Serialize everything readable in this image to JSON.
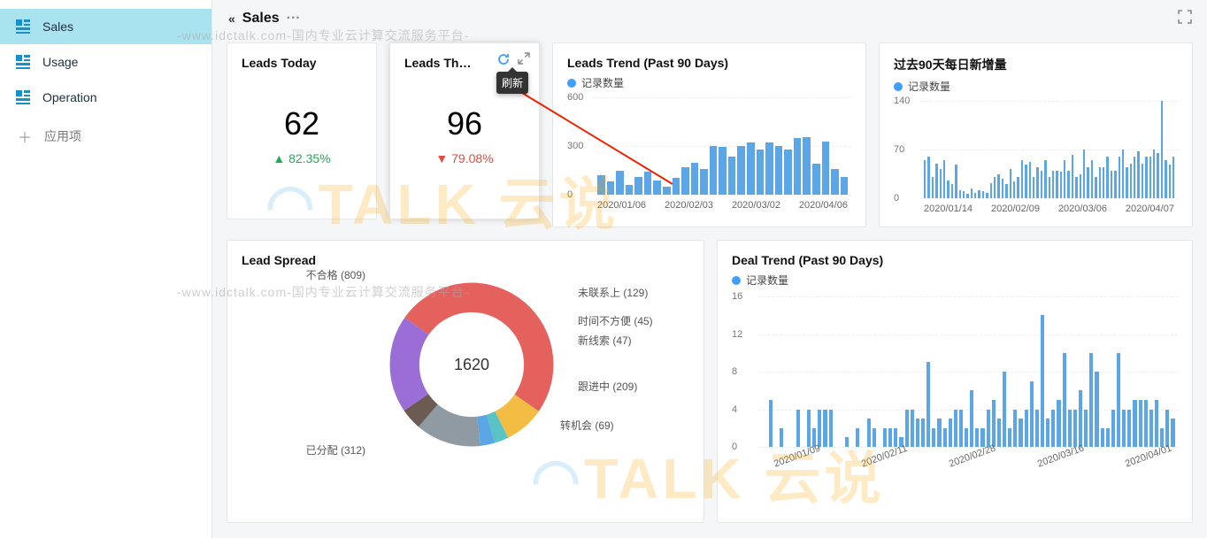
{
  "sidebar": {
    "items": [
      {
        "label": "Sales"
      },
      {
        "label": "Usage"
      },
      {
        "label": "Operation"
      }
    ],
    "add_label": "应用项"
  },
  "header": {
    "collapse_glyph": "«",
    "title": "Sales",
    "more_glyph": "···"
  },
  "tooltip_refresh": "刷新",
  "kpi_today": {
    "title": "Leads Today",
    "value": "62",
    "delta": "82.35%",
    "direction": "up"
  },
  "kpi_week": {
    "title": "Leads Th…",
    "value": "96",
    "delta": "79.08%",
    "direction": "down"
  },
  "leads_trend": {
    "title": "Leads Trend (Past 90 Days)",
    "legend": "记录数量",
    "ylim": [
      0,
      600
    ],
    "yticks": [
      "600",
      "300",
      "0"
    ],
    "xlabels": [
      "2020/01/06",
      "2020/02/03",
      "2020/03/02",
      "2020/04/06"
    ],
    "values": [
      120,
      80,
      145,
      60,
      110,
      140,
      90,
      50,
      105,
      170,
      195,
      160,
      300,
      295,
      235,
      300,
      320,
      280,
      320,
      300,
      280,
      350,
      355,
      190,
      325,
      160,
      110
    ]
  },
  "daily_new": {
    "title": "过去90天每日新增量",
    "legend": "记录数量",
    "ylim": [
      0,
      140
    ],
    "yticks": [
      "140",
      "70",
      "0"
    ],
    "xlabels": [
      "2020/01/14",
      "2020/02/09",
      "2020/03/06",
      "2020/04/07"
    ],
    "values": [
      55,
      60,
      30,
      50,
      42,
      55,
      26,
      20,
      48,
      12,
      10,
      6,
      14,
      8,
      12,
      10,
      8,
      22,
      30,
      35,
      28,
      20,
      42,
      24,
      30,
      55,
      48,
      52,
      30,
      44,
      40,
      55,
      30,
      40,
      40,
      38,
      55,
      40,
      62,
      30,
      35,
      70,
      45,
      55,
      30,
      44,
      45,
      60,
      40,
      40,
      60,
      70,
      45,
      50,
      60,
      68,
      50,
      60,
      60,
      70,
      65,
      140,
      55,
      48,
      60
    ]
  },
  "lead_spread": {
    "title": "Lead Spread",
    "total": "1620",
    "slices": [
      {
        "label": "不合格 (809)",
        "value": 809,
        "color": "#e5615e"
      },
      {
        "label": "未联系上 (129)",
        "value": 129,
        "color": "#f2bd42"
      },
      {
        "label": "时间不方便 (45)",
        "value": 45,
        "color": "#58c4c8"
      },
      {
        "label": "新线索 (47)",
        "value": 47,
        "color": "#5aa6e6"
      },
      {
        "label": "跟进中 (209)",
        "value": 209,
        "color": "#8f9aa3"
      },
      {
        "label": "转机会 (69)",
        "value": 69,
        "color": "#6b5b52"
      },
      {
        "label": "已分配 (312)",
        "value": 312,
        "color": "#9a6dd7"
      }
    ]
  },
  "deal_trend": {
    "title": "Deal Trend (Past 90 Days)",
    "legend": "记录数量",
    "ylim": [
      0,
      16
    ],
    "yticks": [
      "16",
      "12",
      "8",
      "4",
      "0"
    ],
    "xlabels": [
      "2020/01/09",
      "2020/02/11",
      "2020/02/28",
      "2020/03/16",
      "2020/04/01"
    ],
    "values": [
      5,
      0,
      2,
      0,
      0,
      4,
      0,
      4,
      2,
      4,
      4,
      4,
      0,
      0,
      1,
      0,
      2,
      0,
      3,
      2,
      0,
      2,
      2,
      2,
      1,
      4,
      4,
      3,
      3,
      9,
      2,
      3,
      2,
      3,
      4,
      4,
      2,
      6,
      2,
      2,
      4,
      5,
      3,
      8,
      2,
      4,
      3,
      4,
      7,
      4,
      14,
      3,
      4,
      5,
      10,
      4,
      4,
      6,
      4,
      10,
      8,
      2,
      2,
      4,
      10,
      4,
      4,
      5,
      5,
      5,
      4,
      5,
      2,
      4,
      3
    ]
  },
  "watermark_text": "-www.idctalk.com-国内专业云计算交流服务平台-",
  "chart_data": [
    {
      "type": "bar",
      "title": "Leads Trend (Past 90 Days)",
      "series": [
        {
          "name": "记录数量",
          "values": [
            120,
            80,
            145,
            60,
            110,
            140,
            90,
            50,
            105,
            170,
            195,
            160,
            300,
            295,
            235,
            300,
            320,
            280,
            320,
            300,
            280,
            350,
            355,
            190,
            325,
            160,
            110
          ]
        }
      ],
      "x_range": [
        "2020/01/06",
        "2020/04/06"
      ],
      "ylim": [
        0,
        600
      ]
    },
    {
      "type": "bar",
      "title": "过去90天每日新增量",
      "series": [
        {
          "name": "记录数量",
          "values": [
            55,
            60,
            30,
            50,
            42,
            55,
            26,
            20,
            48,
            12,
            10,
            6,
            14,
            8,
            12,
            10,
            8,
            22,
            30,
            35,
            28,
            20,
            42,
            24,
            30,
            55,
            48,
            52,
            30,
            44,
            40,
            55,
            30,
            40,
            40,
            38,
            55,
            40,
            62,
            30,
            35,
            70,
            45,
            55,
            30,
            44,
            45,
            60,
            40,
            40,
            60,
            70,
            45,
            50,
            60,
            68,
            50,
            60,
            60,
            70,
            65,
            140,
            55,
            48,
            60
          ]
        }
      ],
      "x_range": [
        "2020/01/14",
        "2020/04/07"
      ],
      "ylim": [
        0,
        140
      ]
    },
    {
      "type": "pie",
      "title": "Lead Spread",
      "total": 1620,
      "series": [
        {
          "name": "不合格",
          "value": 809
        },
        {
          "name": "未联系上",
          "value": 129
        },
        {
          "name": "时间不方便",
          "value": 45
        },
        {
          "name": "新线索",
          "value": 47
        },
        {
          "name": "跟进中",
          "value": 209
        },
        {
          "name": "转机会",
          "value": 69
        },
        {
          "name": "已分配",
          "value": 312
        }
      ]
    },
    {
      "type": "bar",
      "title": "Deal Trend (Past 90 Days)",
      "series": [
        {
          "name": "记录数量",
          "values": [
            5,
            0,
            2,
            0,
            0,
            4,
            0,
            4,
            2,
            4,
            4,
            4,
            0,
            0,
            1,
            0,
            2,
            0,
            3,
            2,
            0,
            2,
            2,
            2,
            1,
            4,
            4,
            3,
            3,
            9,
            2,
            3,
            2,
            3,
            4,
            4,
            2,
            6,
            2,
            2,
            4,
            5,
            3,
            8,
            2,
            4,
            3,
            4,
            7,
            4,
            14,
            3,
            4,
            5,
            10,
            4,
            4,
            6,
            4,
            10,
            8,
            2,
            2,
            4,
            10,
            4,
            4,
            5,
            5,
            5,
            4,
            5,
            2,
            4,
            3
          ]
        }
      ],
      "x_range": [
        "2020/01/09",
        "2020/04/01"
      ],
      "ylim": [
        0,
        16
      ]
    }
  ]
}
